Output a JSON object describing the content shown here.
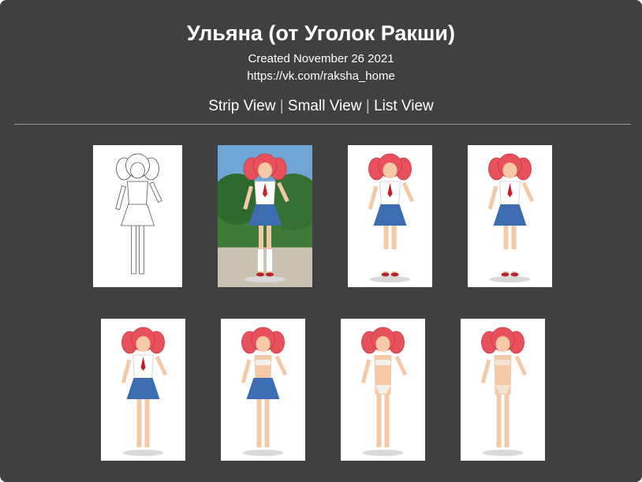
{
  "header": {
    "title": "Ульяна (от Уголок Ракши)",
    "created": "Created November 26 2021",
    "link": "https://vk.com/raksha_home"
  },
  "views": {
    "strip": "Strip View",
    "small": "Small View",
    "list": "List View",
    "separator": "|"
  },
  "gallery": {
    "thumbnails": [
      {
        "style": "pencil-sketch",
        "outfit": "uniform"
      },
      {
        "style": "park-background",
        "outfit": "uniform"
      },
      {
        "style": "white-background",
        "outfit": "uniform"
      },
      {
        "style": "white-background",
        "outfit": "uniform"
      },
      {
        "style": "white-background",
        "outfit": "uniform-barefoot"
      },
      {
        "style": "white-background",
        "outfit": "bikini-top-skirt"
      },
      {
        "style": "white-background",
        "outfit": "bikini"
      },
      {
        "style": "white-background",
        "outfit": "underwear"
      }
    ]
  },
  "colors": {
    "background": "#404040",
    "text": "#ffffff",
    "hair": "#e8505b",
    "skirt": "#3b6db0",
    "tie": "#c8202a",
    "skin": "#f3c9a8"
  }
}
